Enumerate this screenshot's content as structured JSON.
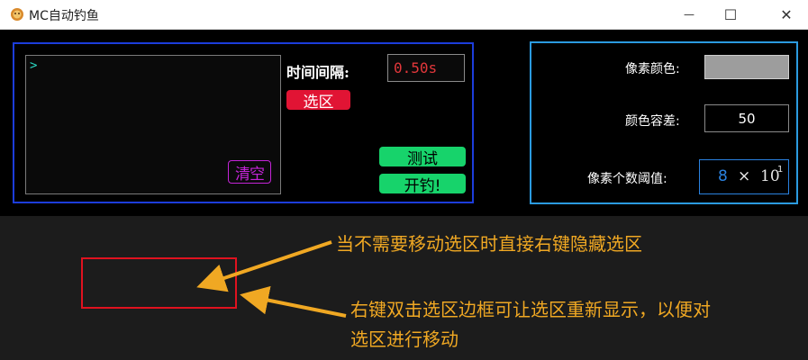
{
  "window": {
    "title": "MC自动钓鱼",
    "minimize_glyph": "—",
    "maximize_glyph": "☐",
    "close_glyph": "✕"
  },
  "controls": {
    "console_prompt": ">",
    "clear_label": "清空",
    "interval_label": "时间间隔:",
    "interval_value": "0.50s",
    "select_region_label": "选区",
    "test_label": "测试",
    "fish_label": "开钓!"
  },
  "settings": {
    "pixel_color_label": "像素颜色:",
    "pixel_color_value": "#9d9d9d",
    "color_tolerance_label": "颜色容差:",
    "color_tolerance_value": "50",
    "pixel_count_threshold_label": "像素个数阈值:",
    "threshold_mantissa": "8",
    "threshold_times": "×",
    "threshold_base": "10",
    "threshold_exponent": "1"
  },
  "annotations": {
    "hide_region_note": "当不需要移动选区时直接右键隐藏选区",
    "show_region_note_line1": "右键双击选区边框可让选区重新显示，以便对",
    "show_region_note_line2": "选区进行移动",
    "arrow_color": "#f0a823",
    "region_border_color": "#e0121f"
  },
  "theme": {
    "left_panel_border": "#1c3ddb",
    "right_panel_border": "#2b9be0",
    "clear_color": "#c424d8",
    "select_button_bg": "#e11434",
    "green_button_bg": "#17d36b"
  }
}
